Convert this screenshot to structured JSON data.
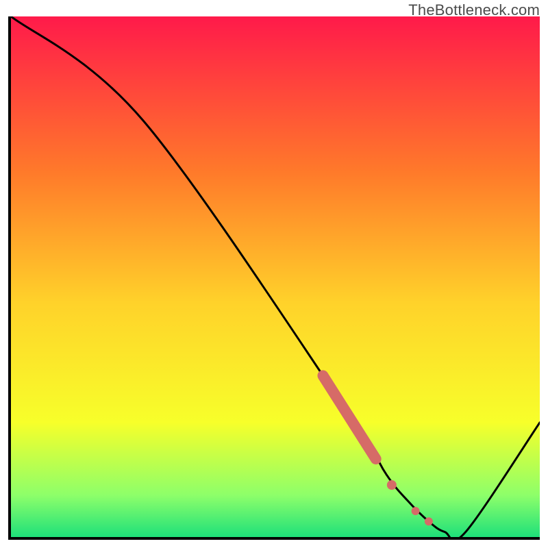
{
  "watermark": "TheBottleneck.com",
  "colors": {
    "gradient_top": "#ff1a4a",
    "gradient_mid_upper": "#ff7a2a",
    "gradient_mid": "#ffd22a",
    "gradient_mid_lower": "#f7ff2a",
    "gradient_low": "#8dff6a",
    "gradient_bottom": "#1ee07a",
    "curve": "#000000",
    "dots": "#d66b67"
  },
  "chart_data": {
    "type": "line",
    "title": "",
    "xlabel": "",
    "ylabel": "",
    "xlim": [
      0,
      100
    ],
    "ylim": [
      0,
      100
    ],
    "series": [
      {
        "name": "bottleneck-curve",
        "x": [
          0,
          25,
          63,
          71,
          75,
          79,
          82,
          86,
          100
        ],
        "y": [
          100,
          80,
          25,
          12,
          7,
          3,
          1,
          1,
          22
        ]
      }
    ],
    "markers": [
      {
        "name": "highlight-segment",
        "type": "thick-segment",
        "x": [
          59,
          69
        ],
        "y": [
          31,
          15
        ]
      },
      {
        "name": "dot-a",
        "type": "dot",
        "x": 72,
        "y": 10
      },
      {
        "name": "dot-b",
        "type": "dot",
        "x": 76.5,
        "y": 5
      },
      {
        "name": "dot-c",
        "type": "dot",
        "x": 79,
        "y": 3
      }
    ]
  }
}
